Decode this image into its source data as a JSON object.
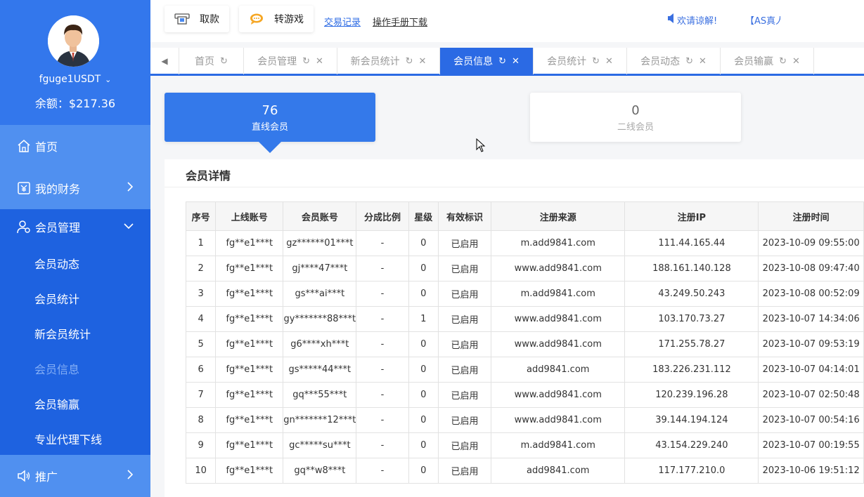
{
  "user": {
    "name": "fguge1USDT",
    "balance_text": "余额：$217.36"
  },
  "sidebar": {
    "home": "首页",
    "finance": "我的财务",
    "members": "会员管理",
    "sub_items": [
      "会员动态",
      "会员统计",
      "新会员统计",
      "会员信息",
      "会员输赢",
      "专业代理下线"
    ],
    "promo": "推广"
  },
  "header": {
    "withdraw": "取款",
    "transfer": "转游戏",
    "trade_record": "交易记录",
    "manual_download": "操作手册下载",
    "notice1": "欢请谅解!",
    "notice2": "【AS真人"
  },
  "tabs": [
    "首页",
    "会员管理",
    "新会员统计",
    "会员信息",
    "会员统计",
    "会员动态",
    "会员输赢"
  ],
  "stats": {
    "direct_count": "76",
    "direct_label": "直线会员",
    "second_count": "0",
    "second_label": "二线会员"
  },
  "panel": {
    "title": "会员详情"
  },
  "table": {
    "headers": [
      "序号",
      "上线账号",
      "会员账号",
      "分成比例",
      "星级",
      "有效标识",
      "注册来源",
      "注册IP",
      "注册时间"
    ],
    "rows": [
      [
        "1",
        "fg**e1***t",
        "gz******01***t",
        "-",
        "0",
        "已启用",
        "m.add9841.com",
        "111.44.165.44",
        "2023-10-09 09:55:00"
      ],
      [
        "2",
        "fg**e1***t",
        "gj****47***t",
        "-",
        "0",
        "已启用",
        "www.add9841.com",
        "188.161.140.128",
        "2023-10-08 09:47:40"
      ],
      [
        "3",
        "fg**e1***t",
        "gs***ai***t",
        "-",
        "0",
        "已启用",
        "m.add9841.com",
        "43.249.50.243",
        "2023-10-08 00:52:09"
      ],
      [
        "4",
        "fg**e1***t",
        "gy*******88***t",
        "-",
        "1",
        "已启用",
        "www.add9841.com",
        "103.170.73.27",
        "2023-10-07 14:34:06"
      ],
      [
        "5",
        "fg**e1***t",
        "g6****xh***t",
        "-",
        "0",
        "已启用",
        "www.add9841.com",
        "171.255.78.27",
        "2023-10-07 09:53:19"
      ],
      [
        "6",
        "fg**e1***t",
        "gs*****44***t",
        "-",
        "0",
        "已启用",
        "add9841.com",
        "183.226.231.112",
        "2023-10-07 04:14:01"
      ],
      [
        "7",
        "fg**e1***t",
        "gq***55***t",
        "-",
        "0",
        "已启用",
        "www.add9841.com",
        "120.239.196.28",
        "2023-10-07 02:50:48"
      ],
      [
        "8",
        "fg**e1***t",
        "gn*******12***t",
        "-",
        "0",
        "已启用",
        "www.add9841.com",
        "39.144.194.124",
        "2023-10-07 00:54:16"
      ],
      [
        "9",
        "fg**e1***t",
        "gc*****su***t",
        "-",
        "0",
        "已启用",
        "m.add9841.com",
        "43.154.229.240",
        "2023-10-07 00:19:55"
      ],
      [
        "10",
        "fg**e1***t",
        "gq**w8***t",
        "-",
        "0",
        "已启用",
        "add9841.com",
        "117.177.210.0",
        "2023-10-06 19:51:12"
      ]
    ]
  },
  "colors": {
    "sidebar": "#1e62e0",
    "accent": "#2b6ae4",
    "sidebar_light": "#5090f0"
  }
}
